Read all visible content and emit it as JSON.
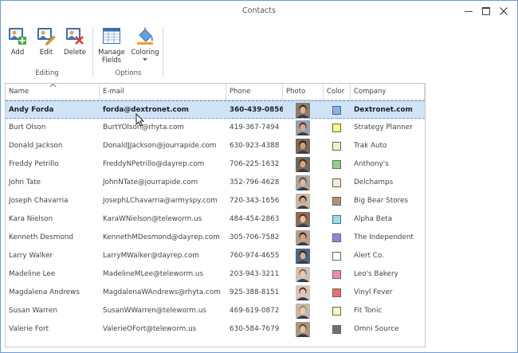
{
  "window": {
    "title": "Contacts"
  },
  "ribbon": {
    "editing": {
      "label": "Editing",
      "add_label": "Add",
      "edit_label": "Edit",
      "delete_label": "Delete"
    },
    "options": {
      "label": "Options",
      "manage_fields_label": "Manage\nFields",
      "coloring_label": "Coloring"
    }
  },
  "grid": {
    "columns": [
      "Name",
      "E-mail",
      "Phone",
      "Photo",
      "Color",
      "Company"
    ],
    "sorted_column": "Name",
    "rows": [
      {
        "name": "Andy Forda",
        "email": "forda@dextronet.com",
        "phone": "360-439-0856",
        "color": "#7fb2f0",
        "company": "Dextronet.com",
        "selected": true,
        "photo_bg": "#8c7a6b",
        "skin": "#e0b08c",
        "hair": "#3b2a20"
      },
      {
        "name": "Burt Olson",
        "email": "BurtYOlson@rhyta.com",
        "phone": "419-367-7494",
        "color": "#fdf77a",
        "company": "Strategy Planner",
        "photo_bg": "#9aa0a8",
        "skin": "#d9a78a",
        "hair": "#4a3a2e"
      },
      {
        "name": "Donald Jackson",
        "email": "DonaldJJackson@jourrapide.com",
        "phone": "630-923-4388",
        "color": "#eaf6c4",
        "company": "Trak Auto",
        "photo_bg": "#7a6858",
        "skin": "#cf9e7e",
        "hair": "#2e2118"
      },
      {
        "name": "Freddy Petrillo",
        "email": "FreddyNPetrillo@dayrep.com",
        "phone": "706-225-1632",
        "color": "#8fd08a",
        "company": "Anthony's",
        "photo_bg": "#6e6a5e",
        "skin": "#d8a682",
        "hair": "#3a2b1f"
      },
      {
        "name": "John Tate",
        "email": "JohnNTate@jourrapide.com",
        "phone": "352-796-4628",
        "color": "#f8e7d3",
        "company": "Delchamps",
        "photo_bg": "#a8a49e",
        "skin": "#e2b89a",
        "hair": "#5b4a3a"
      },
      {
        "name": "Joseph Chavarria",
        "email": "JosephLChavarria@armyspy.com",
        "phone": "720-343-1656",
        "color": "#b39075",
        "company": "Big Bear Stores",
        "photo_bg": "#c8b9a8",
        "skin": "#d7a487",
        "hair": "#2b1e16"
      },
      {
        "name": "Kara Nielson",
        "email": "KaraWNielson@teleworm.us",
        "phone": "484-454-2863",
        "color": "#8ee2f0",
        "company": "Alpha Beta",
        "photo_bg": "#8a6c5e",
        "skin": "#e8c0a0",
        "hair": "#5c2e1e"
      },
      {
        "name": "Kenneth Desmond",
        "email": "KennethMDesmond@dayrep.com",
        "phone": "305-706-7582",
        "color": "#8c88e0",
        "company": "The Independent",
        "photo_bg": "#b0a090",
        "skin": "#d6a080",
        "hair": "#3a2618"
      },
      {
        "name": "Larry Walker",
        "email": "LarryMWalker@dayrep.com",
        "phone": "760-974-4655",
        "color": "#ffffff",
        "company": "Alert Co.",
        "photo_bg": "#4c6888",
        "skin": "#dcae8e",
        "hair": "#2a2420"
      },
      {
        "name": "Madeline Lee",
        "email": "MadelineMLee@teleworm.us",
        "phone": "203-943-3211",
        "color": "#f08aa8",
        "company": "Leo's Bakery",
        "photo_bg": "#c8c2bc",
        "skin": "#ecc8ac",
        "hair": "#8a6040"
      },
      {
        "name": "Magdalena Andrews",
        "email": "MagdalenaWAndrews@rhyta.com",
        "phone": "925-388-8151",
        "color": "#f06e6e",
        "company": "Vinyl Fever",
        "photo_bg": "#d0c8c0",
        "skin": "#ecc4a8",
        "hair": "#4e3424"
      },
      {
        "name": "Susan Warren",
        "email": "SusanWWarren@teleworm.us",
        "phone": "469-619-0872",
        "color": "#fff6b0",
        "company": "Fit Tonic",
        "photo_bg": "#c0b8ae",
        "skin": "#eccaa8",
        "hair": "#a88a60"
      },
      {
        "name": "Valerie Fort",
        "email": "ValerieOFort@teleworm.us",
        "phone": "630-584-7679",
        "color": "#707070",
        "company": "Omni Source",
        "photo_bg": "#a89880",
        "skin": "#e6bea0",
        "hair": "#6a4a2e"
      }
    ]
  }
}
